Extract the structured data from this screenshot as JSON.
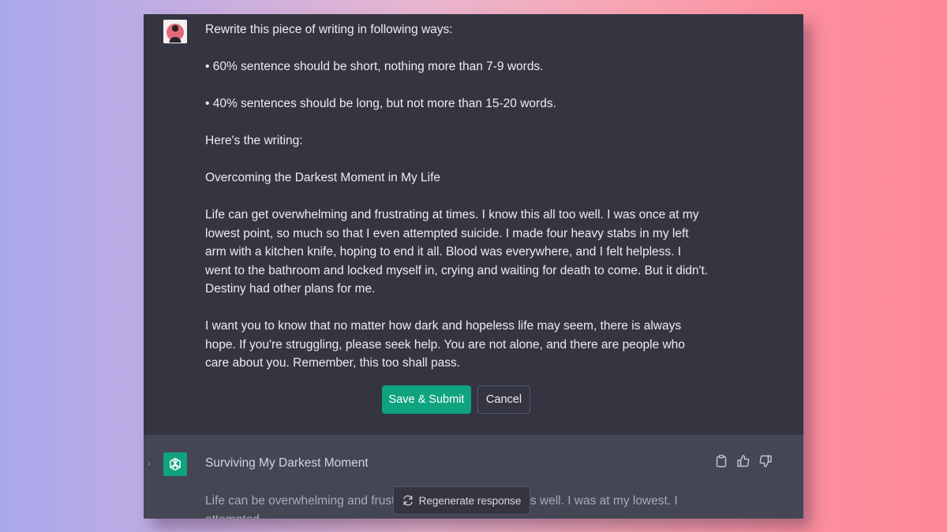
{
  "colors": {
    "background_left": "#a9a8ec",
    "background_right": "#fe8898",
    "user_block_bg": "#343541",
    "assistant_block_bg": "#444654",
    "accent": "#10a37f",
    "text": "#ececf1"
  },
  "user_message": {
    "avatar_icon": "user-avatar-photo",
    "paragraphs": [
      "Rewrite this piece of writing in following ways:",
      "• 60% sentence should be short, nothing more than 7-9 words.",
      "• 40% sentences should be long, but not more than 15-20 words.",
      "Here's the writing:",
      "Overcoming the Darkest Moment in My Life",
      "Life can get overwhelming and frustrating at times. I know this all too well. I was once at my lowest point, so much so that I even attempted suicide. I made four heavy stabs in my left arm with a kitchen knife, hoping to end it all. Blood was everywhere, and I felt helpless. I went to the bathroom and locked myself in, crying and waiting for death to come. But it didn't. Destiny had other plans for me.",
      "I want you to know that no matter how dark and hopeless life may seem, there is always hope. If you're struggling, please seek help. You are not alone, and there are people who care about you. Remember, this too shall pass."
    ],
    "actions": {
      "save_label": "Save & Submit",
      "cancel_label": "Cancel"
    }
  },
  "assistant_message": {
    "avatar_icon": "openai-logo-icon",
    "title": "Surviving My Darkest Moment",
    "body_preview": "Life can be overwhelming and frustrating at times. I know this well. I was at my lowest. I attempted",
    "tools": [
      "clipboard-icon",
      "thumbs-up-icon",
      "thumbs-down-icon"
    ]
  },
  "regenerate": {
    "label": "Regenerate response",
    "icon": "refresh-icon"
  }
}
